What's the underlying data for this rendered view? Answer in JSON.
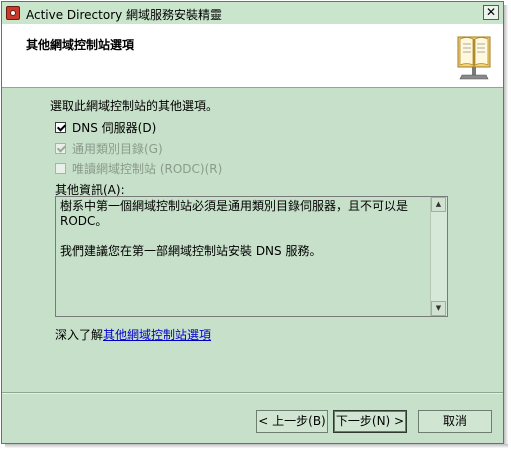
{
  "window": {
    "title": "Active Directory 網域服務安裝精靈",
    "close_glyph": "✕",
    "app_icon": "ad-wizard-icon",
    "close_icon": "close-icon",
    "header_icon": "book-icon"
  },
  "header": {
    "title": "其他網域控制站選項"
  },
  "content": {
    "description": "選取此網域控制站的其他選項。",
    "options": [
      {
        "label": "DNS 伺服器(D)",
        "checked": true,
        "enabled": true
      },
      {
        "label": "通用類別目錄(G)",
        "checked": true,
        "enabled": false
      },
      {
        "label": "唯讀網域控制站 (RODC)(R)",
        "checked": false,
        "enabled": false
      }
    ],
    "info_label": "其他資訊(A):",
    "info_paragraphs": [
      "樹系中第一個網域控制站必須是通用類別目錄伺服器，且不可以是 RODC。",
      "我們建議您在第一部網域控制站安裝 DNS 服務。"
    ],
    "learn_prefix": "深入了解",
    "learn_link": "其他網域控制站選項"
  },
  "buttons": {
    "back": "< 上一步(B)",
    "next": "下一步(N) >",
    "cancel": "取消"
  },
  "colors": {
    "window_bg": "#c7e0c9",
    "header_bg": "#ffffff",
    "link": "#0000cc"
  }
}
